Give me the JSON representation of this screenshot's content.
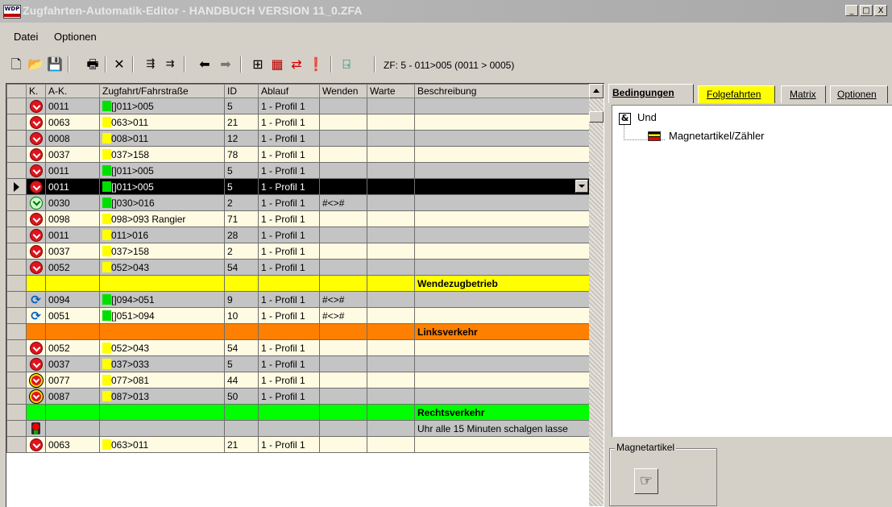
{
  "window": {
    "icon_label": "WDP",
    "title": "Zugfahrten-Automatik-Editor - HANDBUCH VERSION 11_0.ZFA",
    "buttons": [
      "_",
      "□",
      "X"
    ]
  },
  "menu": [
    {
      "label": "Datei"
    },
    {
      "label": "Optionen"
    }
  ],
  "toolbar": {
    "icons": [
      "new-file-icon",
      "open-folder-icon",
      "save-icon",
      "print-icon",
      "delete-icon",
      "insert-row-icon",
      "append-row-icon",
      "arrow-left-icon",
      "arrow-right-icon",
      "layout-icon",
      "table-icon",
      "swap-icon",
      "warning-icon",
      "exit-icon"
    ],
    "status": "ZF: 5 - 011>005 (0011 > 0005)"
  },
  "grid": {
    "columns": [
      "K.",
      "A-K.",
      "Zugfahrt/Fahrstraße",
      "ID",
      "Ablauf",
      "Wenden",
      "Warte",
      "Beschreibung"
    ],
    "rows": [
      {
        "style": "rg",
        "k": "red",
        "ak": "0011",
        "sw": "green",
        "zf": "[]011>005",
        "id": "5",
        "ablauf": "1 - Profil 1",
        "wenden": "",
        "warte": "",
        "desc": ""
      },
      {
        "style": "ry",
        "k": "red",
        "ak": "0063",
        "sw": "yellow",
        "zf": "063>011",
        "id": "21",
        "ablauf": "1 - Profil 1",
        "wenden": "",
        "warte": "",
        "desc": ""
      },
      {
        "style": "rg",
        "k": "red",
        "ak": "0008",
        "sw": "yellow",
        "zf": "008>011",
        "id": "12",
        "ablauf": "1 - Profil 1",
        "wenden": "",
        "warte": "",
        "desc": ""
      },
      {
        "style": "ry",
        "k": "red",
        "ak": "0037",
        "sw": "yellow",
        "zf": "037>158",
        "id": "78",
        "ablauf": "1 - Profil 1",
        "wenden": "",
        "warte": "",
        "desc": ""
      },
      {
        "style": "rg",
        "k": "red",
        "ak": "0011",
        "sw": "green",
        "zf": "[]011>005",
        "id": "5",
        "ablauf": "1 - Profil 1",
        "wenden": "",
        "warte": "",
        "desc": ""
      },
      {
        "style": "sel",
        "k": "red",
        "ak": "0011",
        "sw": "green",
        "zf": "[]011>005",
        "id": "5",
        "ablauf": "1 - Profil 1",
        "wenden": "",
        "warte": "",
        "desc": "",
        "selected": true
      },
      {
        "style": "rg",
        "k": "green",
        "ak": "0030",
        "sw": "green",
        "zf": "[]030>016",
        "id": "2",
        "ablauf": "1 - Profil 1",
        "wenden": "#<>#",
        "warte": "",
        "desc": ""
      },
      {
        "style": "ry",
        "k": "red",
        "ak": "0098",
        "sw": "yellow",
        "zf": "098>093 Rangier",
        "id": "71",
        "ablauf": "1 - Profil 1",
        "wenden": "",
        "warte": "",
        "desc": ""
      },
      {
        "style": "rg",
        "k": "red",
        "ak": "0011",
        "sw": "yellow",
        "zf": "011>016",
        "id": "28",
        "ablauf": "1 - Profil 1",
        "wenden": "",
        "warte": "",
        "desc": ""
      },
      {
        "style": "ry",
        "k": "red",
        "ak": "0037",
        "sw": "yellow",
        "zf": "037>158",
        "id": "2",
        "ablauf": "1 - Profil 1",
        "wenden": "",
        "warte": "",
        "desc": ""
      },
      {
        "style": "rg",
        "k": "red",
        "ak": "0052",
        "sw": "yellow",
        "zf": "052>043",
        "id": "54",
        "ablauf": "1 - Profil 1",
        "wenden": "",
        "warte": "",
        "desc": ""
      },
      {
        "style": "sec-yellow",
        "section": "Wendezugbetrieb"
      },
      {
        "style": "rg",
        "k": "refresh",
        "ak": "0094",
        "sw": "green",
        "zf": "[]094>051",
        "id": "9",
        "ablauf": "1 - Profil 1",
        "wenden": "#<>#",
        "warte": "",
        "desc": ""
      },
      {
        "style": "ry",
        "k": "refresh",
        "ak": "0051",
        "sw": "green",
        "zf": "[]051>094",
        "id": "10",
        "ablauf": "1 - Profil 1",
        "wenden": "#<>#",
        "warte": "",
        "desc": ""
      },
      {
        "style": "sec-orange",
        "section": "Linksverkehr"
      },
      {
        "style": "ry",
        "k": "red",
        "ak": "0052",
        "sw": "yellow",
        "zf": "052>043",
        "id": "54",
        "ablauf": "1 - Profil 1",
        "wenden": "",
        "warte": "",
        "desc": ""
      },
      {
        "style": "rg",
        "k": "red",
        "ak": "0037",
        "sw": "yellow",
        "zf": "037>033",
        "id": "5",
        "ablauf": "1 - Profil 1",
        "wenden": "",
        "warte": "",
        "desc": ""
      },
      {
        "style": "ry",
        "k": "yellowring",
        "ak": "0077",
        "sw": "yellow",
        "zf": "077>081",
        "id": "44",
        "ablauf": "1 - Profil 1",
        "wenden": "",
        "warte": "",
        "desc": ""
      },
      {
        "style": "rg",
        "k": "yellowring",
        "ak": "0087",
        "sw": "yellow",
        "zf": "087>013",
        "id": "50",
        "ablauf": "1 - Profil 1",
        "wenden": "",
        "warte": "",
        "desc": ""
      },
      {
        "style": "sec-green",
        "section": "Rechtsverkehr"
      },
      {
        "style": "sec-gray",
        "k": "signal",
        "desc": "Uhr alle 15 Minuten schalgen lasse"
      },
      {
        "style": "ry",
        "k": "red",
        "ak": "0063",
        "sw": "yellow",
        "zf": "063>011",
        "id": "21",
        "ablauf": "1 - Profil 1",
        "wenden": "",
        "warte": "",
        "desc": ""
      }
    ]
  },
  "right_panel": {
    "tabs": [
      {
        "label": "Bedingungen",
        "active": true
      },
      {
        "label": "Folgefahrten",
        "highlight": true
      },
      {
        "label": "Matrix"
      },
      {
        "label": "Optionen"
      }
    ],
    "tree": {
      "root_label": "Und",
      "root_symbol": "&",
      "child_label": "Magnetartikel/Zähler"
    },
    "group": {
      "label": "Magnetartikel"
    }
  }
}
